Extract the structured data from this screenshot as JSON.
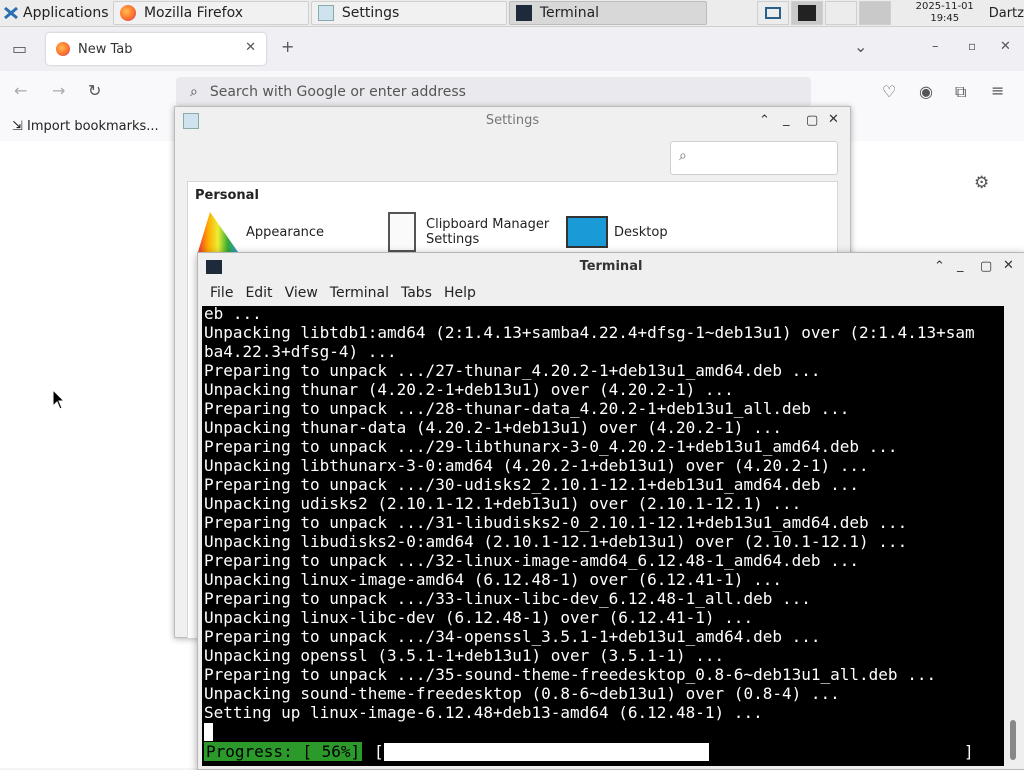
{
  "panel": {
    "applications": "Applications",
    "tasks": [
      "Mozilla Firefox",
      "Settings",
      "Terminal"
    ],
    "clock_date": "2025-11-01",
    "clock_time": "19:45",
    "user": "Dartz"
  },
  "firefox": {
    "tab_title": "New Tab",
    "search_placeholder": "Search with Google or enter address",
    "import_bookmarks": "Import bookmarks..."
  },
  "settings": {
    "title": "Settings",
    "section": "Personal",
    "items": [
      "Appearance",
      "Clipboard Manager Settings",
      "Desktop"
    ]
  },
  "terminal": {
    "title": "Terminal",
    "menu": [
      "File",
      "Edit",
      "View",
      "Terminal",
      "Tabs",
      "Help"
    ],
    "lines": [
      "eb ...",
      "Unpacking libtdb1:amd64 (2:1.4.13+samba4.22.4+dfsg-1~deb13u1) over (2:1.4.13+sam",
      "ba4.22.3+dfsg-4) ...",
      "Preparing to unpack .../27-thunar_4.20.2-1+deb13u1_amd64.deb ...",
      "Unpacking thunar (4.20.2-1+deb13u1) over (4.20.2-1) ...",
      "Preparing to unpack .../28-thunar-data_4.20.2-1+deb13u1_all.deb ...",
      "Unpacking thunar-data (4.20.2-1+deb13u1) over (4.20.2-1) ...",
      "Preparing to unpack .../29-libthunarx-3-0_4.20.2-1+deb13u1_amd64.deb ...",
      "Unpacking libthunarx-3-0:amd64 (4.20.2-1+deb13u1) over (4.20.2-1) ...",
      "Preparing to unpack .../30-udisks2_2.10.1-12.1+deb13u1_amd64.deb ...",
      "Unpacking udisks2 (2.10.1-12.1+deb13u1) over (2.10.1-12.1) ...",
      "Preparing to unpack .../31-libudisks2-0_2.10.1-12.1+deb13u1_amd64.deb ...",
      "Unpacking libudisks2-0:amd64 (2.10.1-12.1+deb13u1) over (2.10.1-12.1) ...",
      "Preparing to unpack .../32-linux-image-amd64_6.12.48-1_amd64.deb ...",
      "Unpacking linux-image-amd64 (6.12.48-1) over (6.12.41-1) ...",
      "Preparing to unpack .../33-linux-libc-dev_6.12.48-1_all.deb ...",
      "Unpacking linux-libc-dev (6.12.48-1) over (6.12.41-1) ...",
      "Preparing to unpack .../34-openssl_3.5.1-1+deb13u1_amd64.deb ...",
      "Unpacking openssl (3.5.1-1+deb13u1) over (3.5.1-1) ...",
      "Preparing to unpack .../35-sound-theme-freedesktop_0.8-6~deb13u1_all.deb ...",
      "Unpacking sound-theme-freedesktop (0.8-6~deb13u1) over (0.8-4) ...",
      "Setting up linux-image-6.12.48+deb13-amd64 (6.12.48-1) ..."
    ],
    "progress_label": "Progress: [ 56%]",
    "progress_fraction": 0.56
  },
  "colors": {
    "progress_green": "#2b9a2b",
    "terminal_bg": "#000000"
  }
}
